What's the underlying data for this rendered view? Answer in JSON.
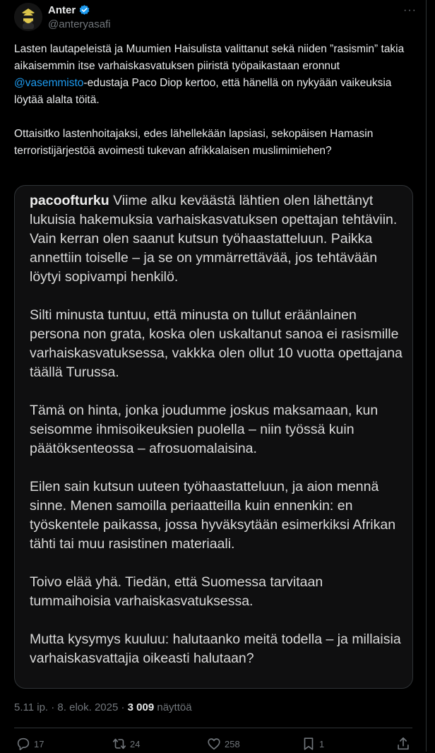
{
  "author": {
    "display_name": "Anter",
    "handle": "@anteryasafi",
    "verified_icon": "verified-badge-icon",
    "more_label": "···"
  },
  "tweet": {
    "line1_before": "Lasten lautapeleistä ja Muumien Haisulista valittanut sekä niiden ”rasismin” takia aikaisemmin itse varhaiskasvatuksen piiristä työpaikastaan eronnut ",
    "mention": "@vasemmisto",
    "line1_after": "-edustaja Paco Diop kertoo, että hänellä on nykyään vaikeuksia löytää alalta töitä.",
    "paragraph2": "Ottaisitko lastenhoitajaksi, edes lähellekään lapsiasi, sekopäisen Hamasin terroristijärjestöä avoimesti tukevan afrikkalaisen muslimimiehen?"
  },
  "media": {
    "username": "pacoofturku",
    "p1": " Viime alku keväästä lähtien olen lähettänyt lukuisia hakemuksia varhaiskasvatuksen opettajan tehtäviin. Vain kerran olen saanut kutsun työhaastatteluun. Paikka annettiin toiselle – ja se on ymmärrettävää, jos tehtävään löytyi sopivampi henkilö.",
    "p2": "Silti minusta tuntuu, että minusta on tullut eräänlainen persona non grata, koska olen uskaltanut sanoa ei rasismille varhaiskasvatuksessa, vakkka olen ollut 10 vuotta opettajana täällä Turussa.",
    "p3": "Tämä on hinta, jonka joudumme joskus maksamaan, kun seisomme ihmisoikeuksien puolella – niin työssä kuin päätöksenteossa – afrosuomalaisina.",
    "p4": "Eilen sain kutsun uuteen työhaastatteluun, ja aion mennä sinne. Menen samoilla periaatteilla kuin ennenkin: en työskentele paikassa, jossa hyväksytään esimerkiksi Afrikan tähti tai muu rasistinen materiaali.",
    "p5": "Toivo elää yhä. Tiedän, että Suomessa tarvitaan tummaihoisia varhaiskasvatuksessa.",
    "p6": "Mutta kysymys kuuluu: halutaanko meitä todella – ja millaisia varhaiskasvattajia oikeasti halutaan?"
  },
  "meta": {
    "timestamp": "5.11 ip. · 8. elok. 2025 · ",
    "views_count": "3 009",
    "views_label": " näyttöä"
  },
  "actions": {
    "replies": "17",
    "reposts": "24",
    "likes": "258",
    "bookmarks": "1"
  },
  "colors": {
    "background": "#000000",
    "text": "#e7e9ea",
    "secondary": "#71767b",
    "accent": "#1d9bf0",
    "border": "#2f3336"
  }
}
